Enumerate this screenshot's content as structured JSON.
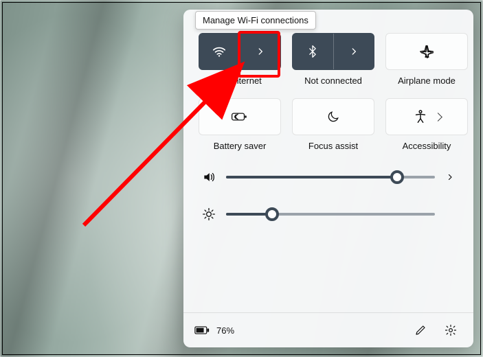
{
  "tooltip": {
    "text": "Manage Wi-Fi connections"
  },
  "tiles": {
    "wifi": {
      "label": "No internet"
    },
    "bluetooth": {
      "label": "Not connected"
    },
    "airplane": {
      "label": "Airplane mode"
    },
    "battery": {
      "label": "Battery saver"
    },
    "focus": {
      "label": "Focus assist"
    },
    "accessibility": {
      "label": "Accessibility"
    }
  },
  "sliders": {
    "volume": {
      "percent": 82
    },
    "brightness": {
      "percent": 22
    }
  },
  "footer": {
    "battery_text": "76%"
  },
  "colors": {
    "accent_dark": "#3d4a57",
    "highlight": "#ff0000"
  }
}
